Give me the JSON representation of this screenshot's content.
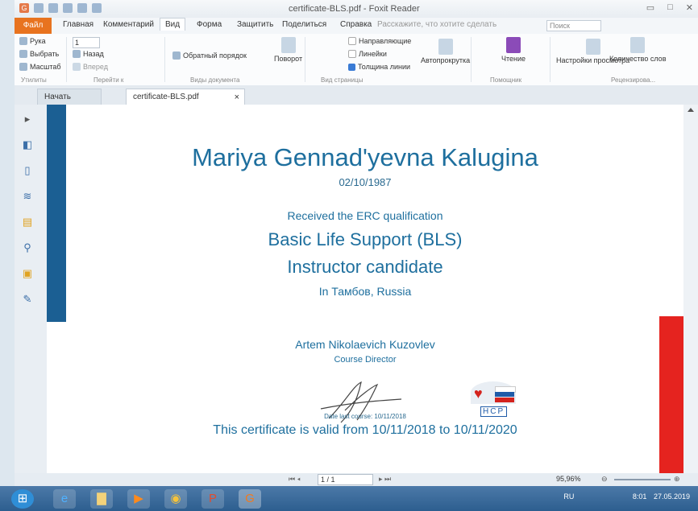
{
  "window": {
    "title": "certificate-BLS.pdf - Foxit Reader"
  },
  "ribbon_tabs": [
    "Файл",
    "Главная",
    "Комментарий",
    "Вид",
    "Форма",
    "Защитить",
    "Поделиться",
    "Справка"
  ],
  "tellme": "Расскажите, что хотите сделать",
  "search_placeholder": "Поиск",
  "ribbon": {
    "hand": "Рука",
    "select": "Выбрать",
    "zoom": "Масштаб",
    "back": "Назад",
    "forward": "Вперед",
    "page_value": "1",
    "reverse_order": "Обратный порядок",
    "rotate": "Поворот",
    "guides": "Направляющие",
    "rulers": "Линейки",
    "line_weight": "Толщина линии",
    "autoscroll": "Автопрокрутка",
    "read": "Чтение",
    "view_settings": "Настройки просмотра",
    "word_count": "Количество слов",
    "groups": {
      "tools": "Утилиты",
      "goto": "Перейти к",
      "doc_views": "Виды документа",
      "page_view": "Вид страницы",
      "assistant": "Помощник",
      "review": "Рецензирова..."
    }
  },
  "doc_tabs": {
    "home": "Начать",
    "doc": "certificate-BLS.pdf"
  },
  "certificate": {
    "name": "Mariya Gennad'yevna Kalugina",
    "dob": "02/10/1987",
    "received": "Received the ERC qualification",
    "course": "Basic Life Support (BLS)",
    "role": "Instructor candidate",
    "location": "In Тамбов, Russia",
    "director": "Artem Nikolaevich Kuzovlev",
    "director_title": "Course Director",
    "date_last": "Date last course: 10/11/2018",
    "validity": "This certificate is valid from 10/11/2018 to 10/11/2020",
    "logo_letters": "НСР"
  },
  "status": {
    "page": "1 / 1",
    "zoom": "95,96%"
  },
  "tray": {
    "lang": "RU",
    "time": "8:01",
    "date": "27.05.2019"
  }
}
